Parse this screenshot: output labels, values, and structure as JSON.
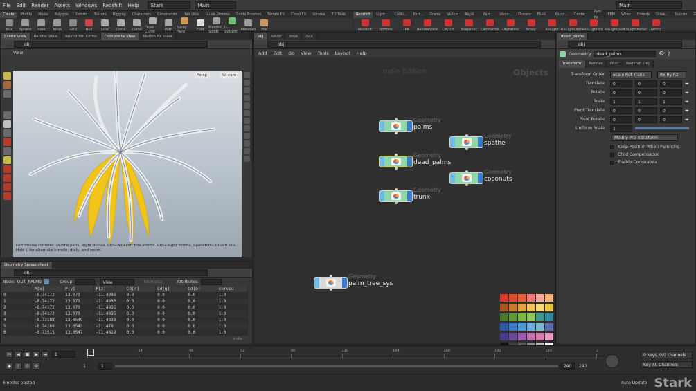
{
  "menubar": {
    "items": [
      "File",
      "Edit",
      "Render",
      "Assets",
      "Windows",
      "Redshift",
      "Help"
    ],
    "desktop": "Stark",
    "build_label": "Main",
    "right_label": "Main"
  },
  "shelf_left": {
    "tabs": [
      "Create",
      "Modify",
      "Model",
      "Polygon",
      "Deform",
      "Texture",
      "Rigging",
      "Characters",
      "Constraints",
      "Hair Utils",
      "Guide Process",
      "Guide Brushes",
      "Terrain FX",
      "Cloud FX",
      "Volume",
      "TD Tools"
    ],
    "tools": [
      {
        "label": "Box",
        "color": "#8a8a8a"
      },
      {
        "label": "Sphere",
        "color": "#9a9a9a"
      },
      {
        "label": "Tube",
        "color": "#9a9a9a"
      },
      {
        "label": "Torus",
        "color": "#9a9a9a"
      },
      {
        "label": "Grid",
        "color": "#888"
      },
      {
        "label": "Null",
        "color": "#c44"
      },
      {
        "label": "Line",
        "color": "#aaa"
      },
      {
        "label": "Circle",
        "color": "#aaa"
      },
      {
        "label": "Curve",
        "color": "#aaa"
      },
      {
        "label": "Draw Curve",
        "color": "#aaa"
      },
      {
        "label": "Path",
        "color": "#aaa"
      },
      {
        "label": "Spray Paint",
        "color": "#c95"
      },
      {
        "label": "Font",
        "color": "#ddd"
      },
      {
        "label": "Platonic Solids",
        "color": "#9a9a9a"
      },
      {
        "label": "L-System",
        "color": "#7b7"
      },
      {
        "label": "Metaball",
        "color": "#9a9a9a"
      },
      {
        "label": "File",
        "color": "#c96"
      }
    ]
  },
  "shelf_right": {
    "tabs": [
      "Redshift",
      "Light...",
      "Collis...",
      "Part...",
      "Grains",
      "Vellum",
      "Rigid...",
      "Part...",
      "Visco...",
      "Oceans",
      "Fluid...",
      "Popul...",
      "Conta...",
      "Pyro FX",
      "FEM",
      "Wires",
      "Crowds",
      "Drive...",
      "Texture",
      "Game..."
    ],
    "tools": [
      {
        "label": "Redshift",
        "color": "#c33"
      },
      {
        "label": "Options",
        "color": "#c33"
      },
      {
        "label": "IPR",
        "color": "#c33"
      },
      {
        "label": "RenderView",
        "color": "#c33"
      },
      {
        "label": "On/Off",
        "color": "#c33"
      },
      {
        "label": "Snapshot",
        "color": "#c33"
      },
      {
        "label": "CamParms",
        "color": "#c33"
      },
      {
        "label": "ObjParms",
        "color": "#c33"
      },
      {
        "label": "Proxy",
        "color": "#c33"
      },
      {
        "label": "RSLight",
        "color": "#c33"
      },
      {
        "label": "RSLightDome",
        "color": "#c33"
      },
      {
        "label": "RSLightIES",
        "color": "#c33"
      },
      {
        "label": "RSLightSun",
        "color": "#c33"
      },
      {
        "label": "RSLightPortal",
        "color": "#c33"
      },
      {
        "label": "About",
        "color": "#c33"
      }
    ]
  },
  "viewport": {
    "tabs": [
      "Scene View",
      "Render View",
      "Animation Editor",
      "Composite View",
      "Motion FX View"
    ],
    "path": "obj",
    "title": "View",
    "persp_label": "Persp",
    "cam_label": "No cam",
    "hint": "Left mouse tumbles. Middle pans. Right dollies. Ctrl+Alt+Left box-zooms. Ctrl+Right zooms. Spacebar-Ctrl-Left tilts. Hold L for alternate tumble, dolly, and zoom."
  },
  "network": {
    "path_tabs": [
      "obj",
      "/shop",
      "/mat",
      "/out"
    ],
    "path": "obj",
    "menu": [
      "Add",
      "Edit",
      "Go",
      "View",
      "Tools",
      "Layout",
      "Help"
    ],
    "watermark": "Indie Edition",
    "context_label": "Objects",
    "nodes": [
      {
        "type": "Geometry",
        "name": "palms"
      },
      {
        "type": "Geometry",
        "name": "spathe"
      },
      {
        "type": "Geometry",
        "name": "dead_palms"
      },
      {
        "type": "Geometry",
        "name": "coconuts"
      },
      {
        "type": "Geometry",
        "name": "trunk"
      },
      {
        "type": "Geometry",
        "name": "palm_tree_sys"
      }
    ],
    "palette": [
      "#d93a2b",
      "#e04b2e",
      "#e8603a",
      "#f07c78",
      "#f7a99c",
      "#f4b47a",
      "#a8581e",
      "#c97a2a",
      "#e3a23c",
      "#f2c25a",
      "#f7db7a",
      "#e8c640",
      "#4a7a2a",
      "#5f9a38",
      "#7ab846",
      "#8ec85a",
      "#3a9a8a",
      "#2a8aa0",
      "#2a5aa8",
      "#3a78c8",
      "#4a98d8",
      "#6ab0e0",
      "#7ab8d0",
      "#5a6ab0",
      "#4a3a8a",
      "#6a4a9a",
      "#9a5ab0",
      "#c070b0",
      "#d87aa8",
      "#e89ac0",
      "#111111",
      "#3a3a3a",
      "#5a5a5a",
      "#8a8a8a",
      "#bcbcbc",
      "#ffffff"
    ]
  },
  "params": {
    "tab": "dead_palms",
    "node_type": "Geometry",
    "node_name": "dead_palms",
    "path": "obj",
    "tabs": [
      "Transform",
      "Render",
      "Misc",
      "Redshift OBJ"
    ],
    "transform_order_label": "Transform Order",
    "transform_order": "Scale Rot Trans",
    "rot_order": "Rx Ry Rz",
    "rows": [
      {
        "label": "Translate",
        "values": [
          "0",
          "0",
          "0"
        ]
      },
      {
        "label": "Rotate",
        "values": [
          "0",
          "0",
          "0"
        ]
      },
      {
        "label": "Scale",
        "values": [
          "1",
          "1",
          "1"
        ]
      },
      {
        "label": "Pivot Translate",
        "values": [
          "0",
          "0",
          "0"
        ]
      },
      {
        "label": "Pivot Rotate",
        "values": [
          "0",
          "0",
          "0"
        ]
      }
    ],
    "uniform_scale_label": "Uniform Scale",
    "uniform_scale": "1",
    "modify_pretransform": "Modify Pre-Transform",
    "checkboxes": [
      "Keep Position When Parenting",
      "Child Compensation",
      "Enable Constraints"
    ]
  },
  "spreadsheet": {
    "tab": "Geometry Spreadsheet",
    "path": "obj",
    "node_label": "Node:",
    "node_value": "OUT_PALMS",
    "group_label": "Group:",
    "view_label": "View",
    "intrinsics_label": "Intrinsics",
    "attributes_label": "Attributes:",
    "columns": [
      "",
      "P[x]",
      "P[y]",
      "P[z]",
      "Cd[r]",
      "Cd[g]",
      "Cd[b]",
      "curveu"
    ],
    "rows": [
      [
        "0",
        "-8.74172",
        "13.073",
        "-11.4986",
        "0.0",
        "0.0",
        "0.0",
        "1.0"
      ],
      [
        "1",
        "-8.74172",
        "13.073",
        "-11.4986",
        "0.0",
        "0.0",
        "0.0",
        "1.0"
      ],
      [
        "2",
        "-8.74172",
        "13.073",
        "-11.4986",
        "0.0",
        "0.0",
        "0.0",
        "1.0"
      ],
      [
        "3",
        "-8.74172",
        "13.073",
        "-11.4986",
        "0.0",
        "0.0",
        "0.0",
        "1.0"
      ],
      [
        "4",
        "-8.73188",
        "13.0549",
        "-11.4838",
        "0.0",
        "0.0",
        "0.0",
        "1.0"
      ],
      [
        "5",
        "-8.74169",
        "13.0543",
        "-11.478",
        "0.0",
        "0.0",
        "0.0",
        "1.0"
      ],
      [
        "6",
        "-8.73515",
        "13.0547",
        "-11.4819",
        "0.0",
        "0.0",
        "0.0",
        "1.0"
      ]
    ],
    "indie_label": "Indie"
  },
  "timeline": {
    "frame": "1",
    "start": "1",
    "range_start": "1",
    "range_end": "240",
    "end": "240",
    "ticks": [
      "1",
      "24",
      "48",
      "72",
      "96",
      "120",
      "144",
      "168",
      "192",
      "216",
      "2"
    ],
    "keys_label": "0 keys, 0/0 channels",
    "key_all_label": "Key All Channels",
    "auto_update": "Auto Update"
  },
  "status": {
    "message": "6 nodes pasted",
    "logo": "Stark"
  }
}
